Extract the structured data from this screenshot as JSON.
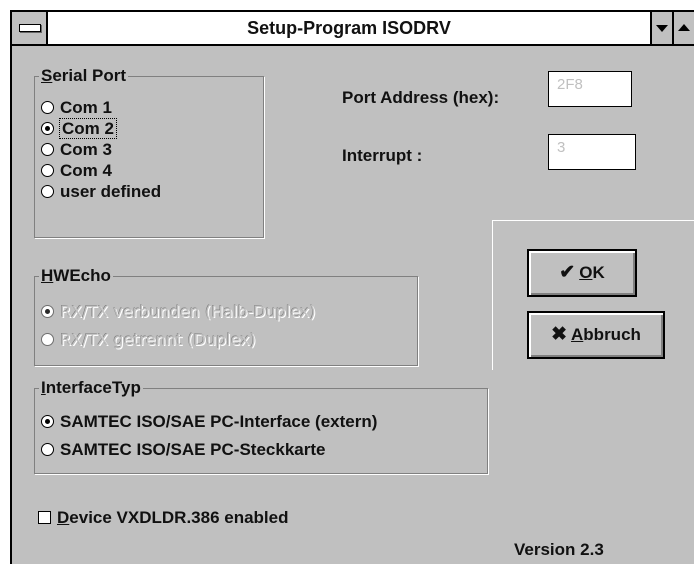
{
  "window": {
    "title": "Setup-Program ISODRV",
    "system_menu_icon": "system-menu-icon",
    "minimize_icon": "triangle-down-icon",
    "maximize_icon": "triangle-up-icon"
  },
  "serial_port": {
    "legend_key": "S",
    "legend_rest": "erial Port",
    "options": [
      {
        "label": "Com 1",
        "selected": false
      },
      {
        "label": "Com 2",
        "selected": true
      },
      {
        "label": "Com 3",
        "selected": false
      },
      {
        "label": "Com 4",
        "selected": false
      },
      {
        "label": "user defined",
        "selected": false
      }
    ]
  },
  "port_address": {
    "label": "Port Address (hex):",
    "value": "2F8"
  },
  "interrupt": {
    "label": "Interrupt :",
    "value": "3"
  },
  "hwecho": {
    "legend_key": "H",
    "legend_rest": "WEcho",
    "options": [
      {
        "label": "RX/TX verbunden (Halb-Duplex)",
        "selected": true,
        "disabled": true
      },
      {
        "label": "RX/TX getrennt (Duplex)",
        "selected": false,
        "disabled": true
      }
    ]
  },
  "interface_typ": {
    "legend_key": "I",
    "legend_rest": "nterfaceTyp",
    "options": [
      {
        "label": "SAMTEC ISO/SAE PC-Interface (extern)",
        "selected": true
      },
      {
        "label": "SAMTEC ISO/SAE PC-Steckkarte",
        "selected": false
      }
    ]
  },
  "buttons": {
    "ok_icon": "checkmark-icon",
    "ok_key": "O",
    "ok_rest": "K",
    "cancel_icon": "x-icon",
    "cancel_key": "A",
    "cancel_rest": "bbruch"
  },
  "device": {
    "key": "D",
    "rest": "evice VXDLDR.386 enabled",
    "checked": false
  },
  "version": "Version 2.3"
}
